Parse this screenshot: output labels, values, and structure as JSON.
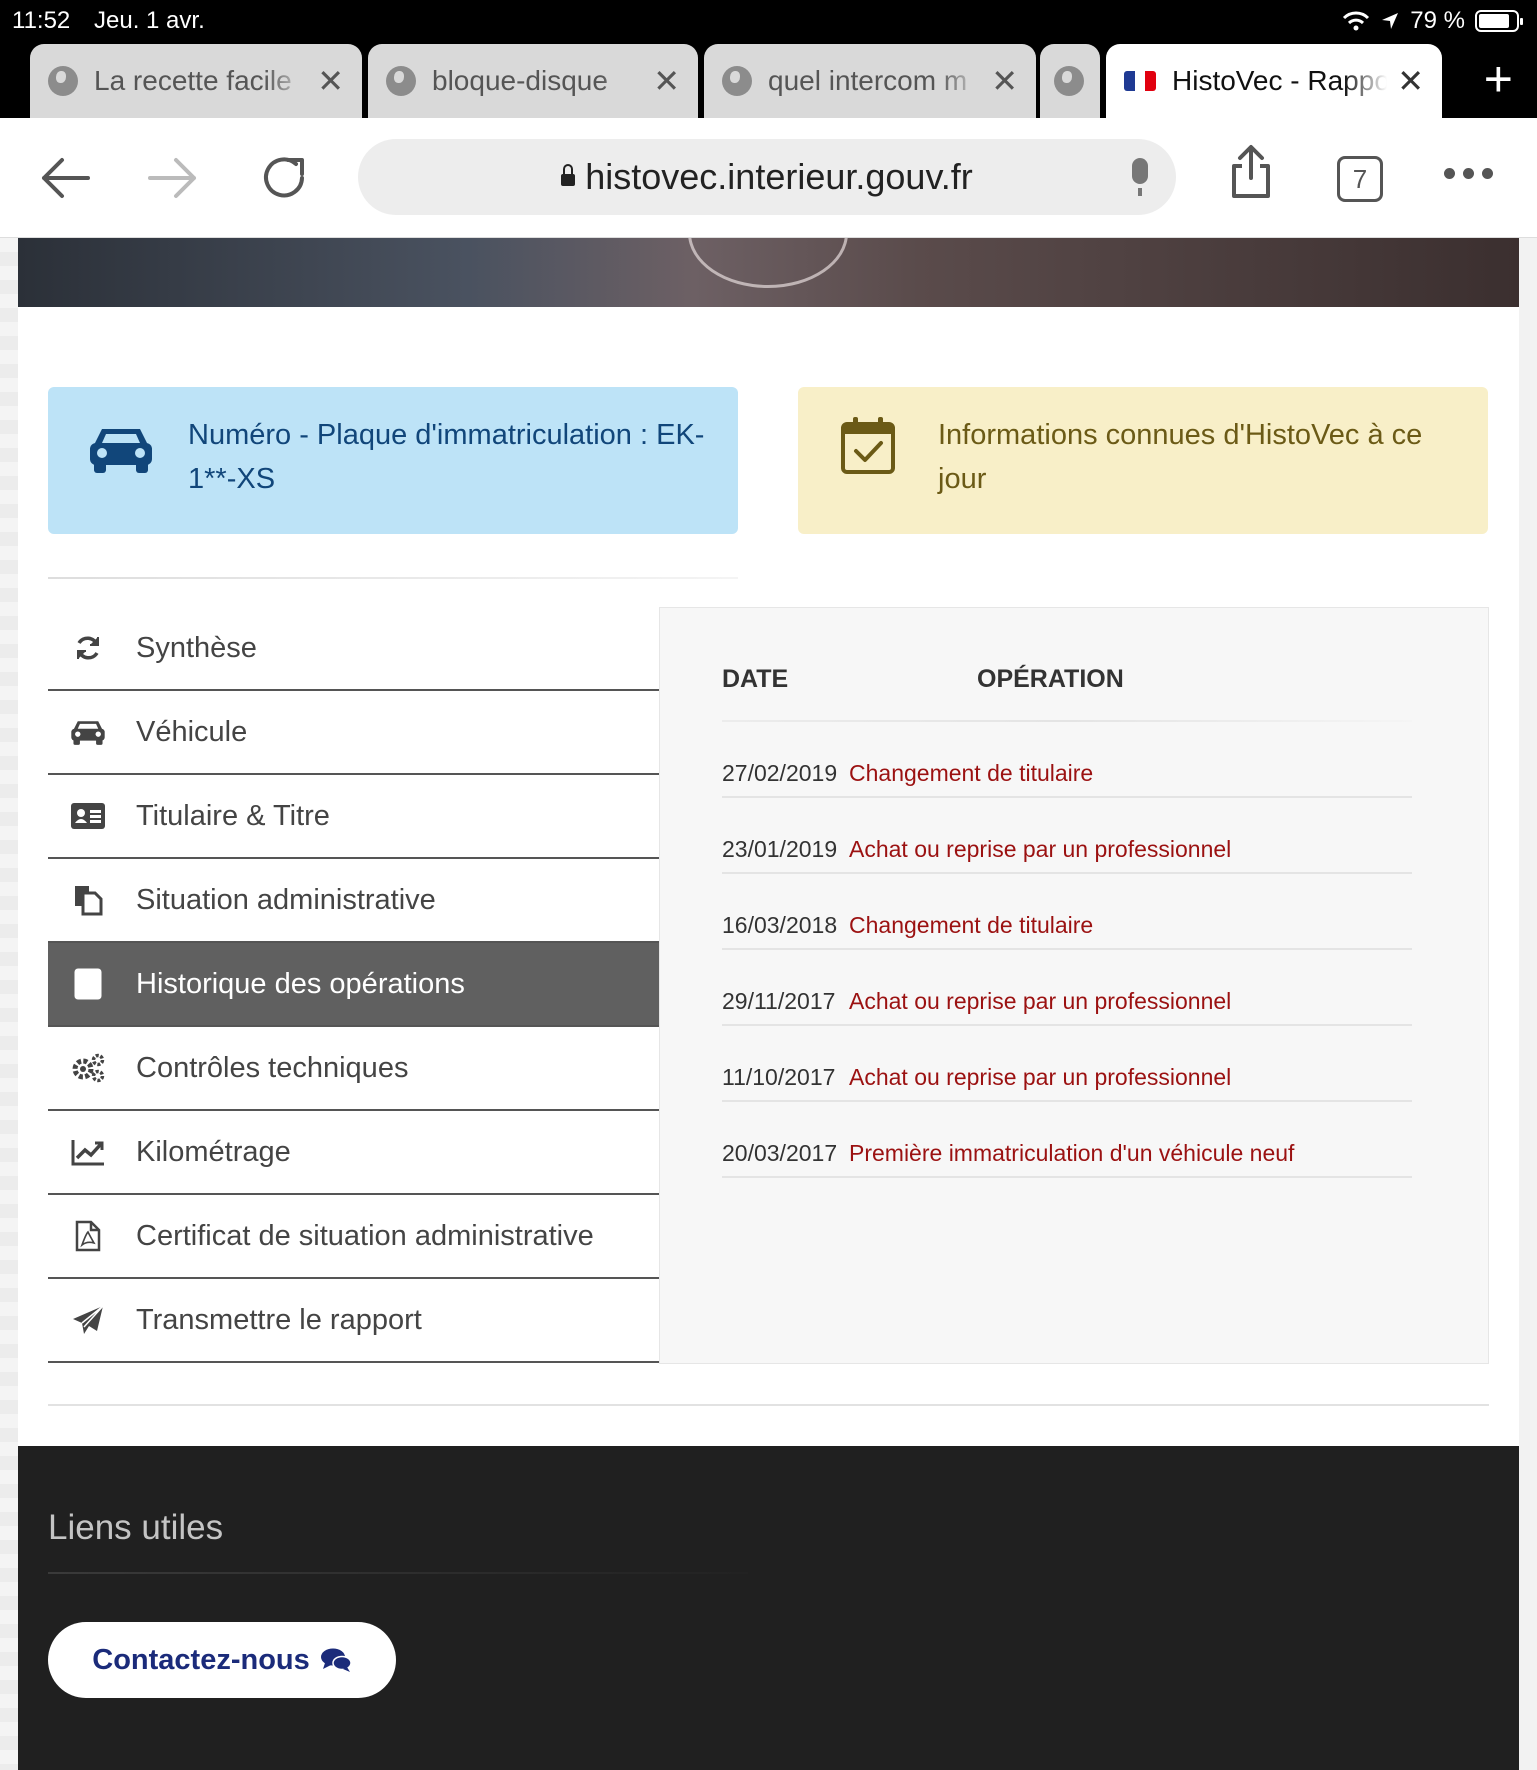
{
  "status_bar": {
    "time": "11:52",
    "date": "Jeu. 1 avr.",
    "battery": "79 %"
  },
  "tabs": [
    {
      "title": "La recette facile",
      "icon": "globe-icon"
    },
    {
      "title": "bloque-disque",
      "icon": "globe-icon"
    },
    {
      "title": "quel intercom m",
      "icon": "globe-icon"
    },
    {
      "title": "HistoVec - Rapport",
      "icon": "french-flag-icon",
      "active": true
    }
  ],
  "toolbar": {
    "url": "histovec.interieur.gouv.fr",
    "tab_count": "7"
  },
  "cards": {
    "plate_label": "Numéro - Plaque d'immatriculation : EK-1**-XS",
    "info_label": "Informations connues d'HistoVec à ce jour"
  },
  "nav": [
    {
      "label": "Synthèse",
      "icon": "refresh-icon"
    },
    {
      "label": "Véhicule",
      "icon": "car-icon"
    },
    {
      "label": "Titulaire & Titre",
      "icon": "id-card-icon"
    },
    {
      "label": "Situation administrative",
      "icon": "documents-icon"
    },
    {
      "label": "Historique des opérations",
      "icon": "calculator-icon",
      "active": true
    },
    {
      "label": "Contrôles techniques",
      "icon": "gears-icon"
    },
    {
      "label": "Kilométrage",
      "icon": "line-chart-icon"
    },
    {
      "label": "Certificat de situation administrative",
      "icon": "pdf-file-icon"
    },
    {
      "label": "Transmettre le rapport",
      "icon": "paper-plane-icon"
    }
  ],
  "history": {
    "headers": {
      "date": "DATE",
      "operation": "OPÉRATION"
    },
    "rows": [
      {
        "date": "27/02/2019",
        "operation": "Changement de titulaire"
      },
      {
        "date": "23/01/2019",
        "operation": "Achat ou reprise par un professionnel"
      },
      {
        "date": "16/03/2018",
        "operation": "Changement de titulaire"
      },
      {
        "date": "29/11/2017",
        "operation": "Achat ou reprise par un professionnel"
      },
      {
        "date": "11/10/2017",
        "operation": "Achat ou reprise par un professionnel"
      },
      {
        "date": "20/03/2017",
        "operation": "Première immatriculation d'un véhicule neuf"
      }
    ]
  },
  "footer": {
    "title": "Liens utiles",
    "contact_label": "Contactez-nous"
  },
  "colors": {
    "operation_text": "#9b1111",
    "active_nav": "#606060",
    "footer_bg": "#202020",
    "contact_text": "#1b2b7a"
  }
}
